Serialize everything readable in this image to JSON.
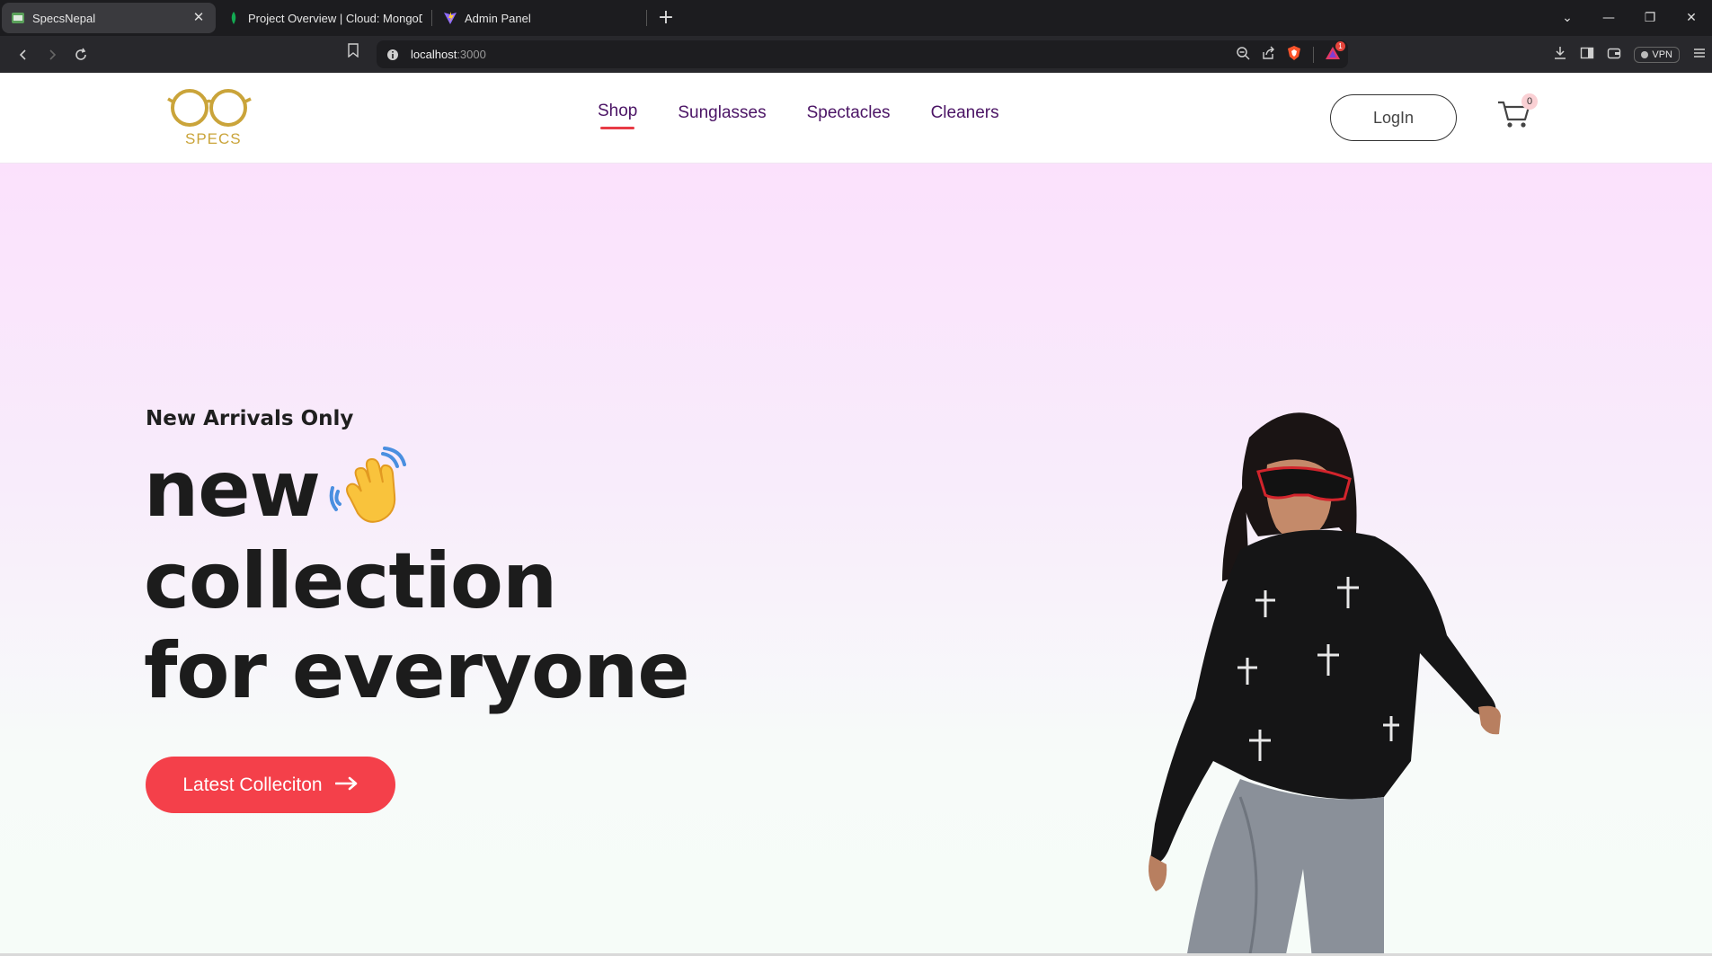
{
  "browser": {
    "tabs": [
      {
        "title": "SpecsNepal",
        "icon": "specsnepal-favicon",
        "active": true
      },
      {
        "title": "Project Overview | Cloud: MongoDB",
        "icon": "mongodb-leaf-icon",
        "active": false
      },
      {
        "title": "Admin Panel",
        "icon": "vite-icon",
        "active": false
      }
    ],
    "address": {
      "host": "localhost",
      "port": ":3000"
    },
    "vpn_label": "VPN",
    "brave_rewards_count": "1"
  },
  "site": {
    "logo_text": "SPECS",
    "nav": [
      {
        "label": "Shop",
        "active": true
      },
      {
        "label": "Sunglasses",
        "active": false
      },
      {
        "label": "Spectacles",
        "active": false
      },
      {
        "label": "Cleaners",
        "active": false
      }
    ],
    "login_label": "LogIn",
    "cart_count": "0",
    "colors": {
      "accent": "#f4404a",
      "nav_text": "#4b1465",
      "logo_gold": "#caa43a"
    }
  },
  "hero": {
    "subtitle": "New Arrivals Only",
    "title_lines": [
      "new",
      "collection",
      "for everyone"
    ],
    "cta_label": "Latest Colleciton"
  }
}
